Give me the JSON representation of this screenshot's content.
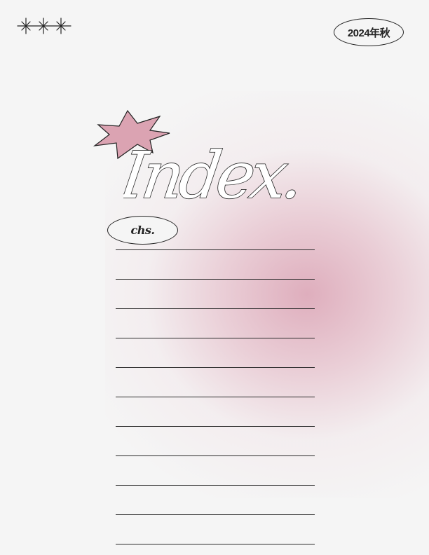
{
  "header": {
    "season_badge": "2024年秋"
  },
  "title": {
    "text": "Index."
  },
  "chapter_badge": {
    "label": "chs."
  },
  "decor": {
    "sparkles_icon": "three-sparkles-icon",
    "star_icon": "burst-star-icon",
    "star_color": "#dba3b2",
    "glow_color": "#d996aa"
  },
  "index_lines": [
    "",
    "",
    "",
    "",
    "",
    "",
    "",
    "",
    "",
    "",
    ""
  ]
}
